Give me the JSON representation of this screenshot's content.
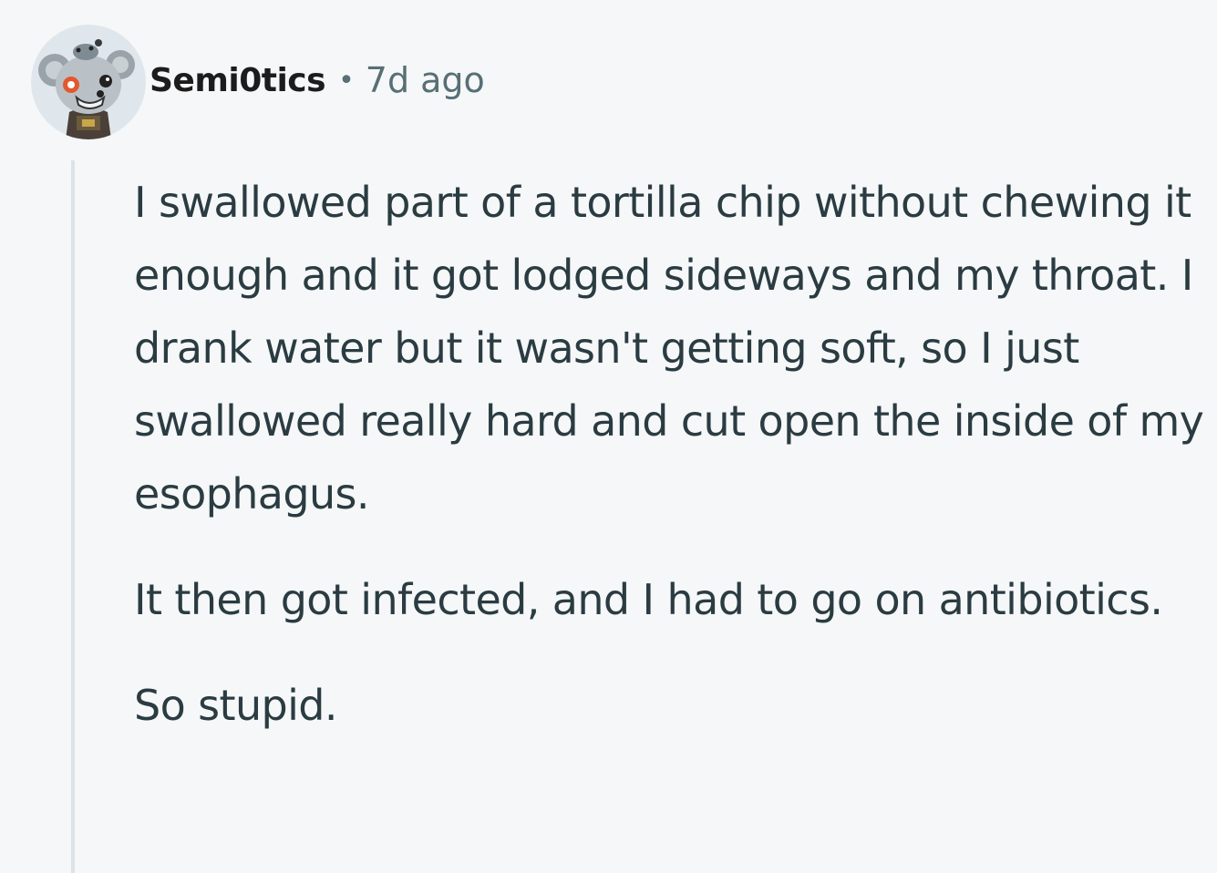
{
  "comment": {
    "author": "Semi0tics",
    "separator": "•",
    "timestamp": "7d ago",
    "paragraphs": [
      "I swallowed part of a tortilla chip without chewing it enough and it got lodged sideways and my throat. I drank water but it wasn't getting soft, so I just swallowed really hard and cut open the inside of my esophagus.",
      "It then got infected, and I had to go on antibiotics.",
      "So stupid."
    ]
  },
  "colors": {
    "background": "#f6f7f8",
    "text": "#2a3c42",
    "meta": "#576f76",
    "thread_line": "#dce3e8"
  },
  "icons": {
    "avatar": "snoo-avatar-icon"
  }
}
